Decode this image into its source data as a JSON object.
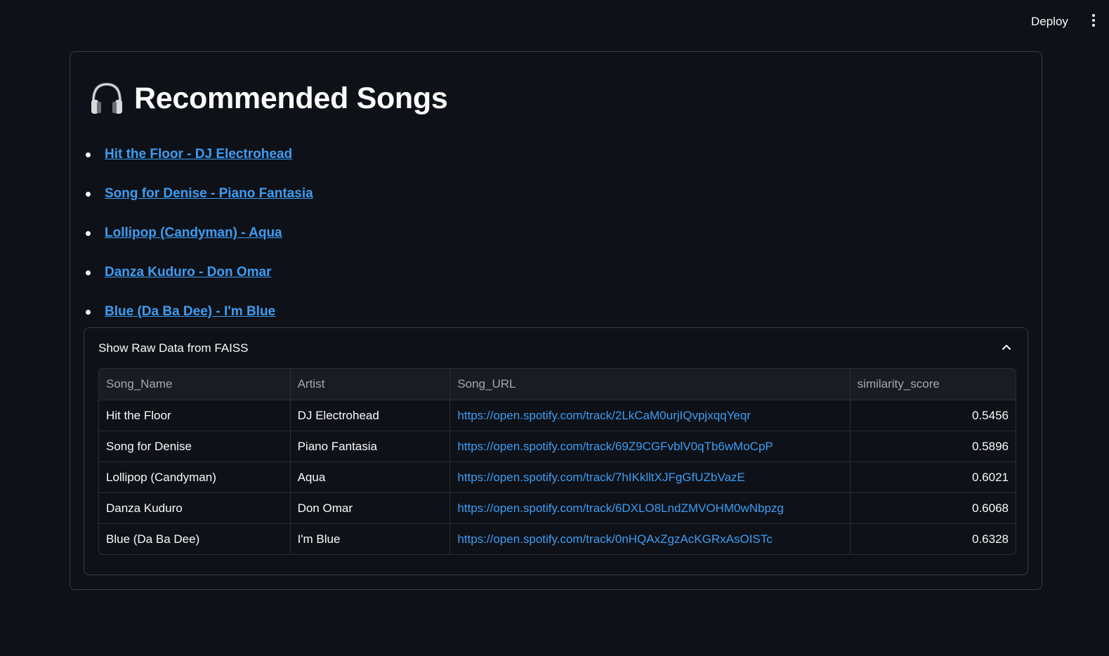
{
  "header": {
    "deploy_label": "Deploy"
  },
  "main": {
    "title": "Recommended Songs",
    "title_icon": "headphones-icon",
    "recommendations": [
      {
        "label": "Hit the Floor - DJ Electrohead"
      },
      {
        "label": "Song for Denise - Piano Fantasia"
      },
      {
        "label": "Lollipop (Candyman) - Aqua"
      },
      {
        "label": "Danza Kuduro - Don Omar"
      },
      {
        "label": "Blue (Da Ba Dee) - I'm Blue"
      }
    ],
    "expander": {
      "label": "Show Raw Data from FAISS",
      "icon": "chevron-up-icon",
      "expanded": true
    },
    "table": {
      "columns": [
        "Song_Name",
        "Artist",
        "Song_URL",
        "similarity_score"
      ],
      "rows": [
        [
          "Hit the Floor",
          "DJ Electrohead",
          "https://open.spotify.com/track/2LkCaM0urjIQvpjxqqYeqr",
          "0.5456"
        ],
        [
          "Song for Denise",
          "Piano Fantasia",
          "https://open.spotify.com/track/69Z9CGFvblV0qTb6wMoCpP",
          "0.5896"
        ],
        [
          "Lollipop (Candyman)",
          "Aqua",
          "https://open.spotify.com/track/7hIKklltXJFgGfUZbVazE",
          "0.6021"
        ],
        [
          "Danza Kuduro",
          "Don Omar",
          "https://open.spotify.com/track/6DXLO8LndZMVOHM0wNbpzg",
          "0.6068"
        ],
        [
          "Blue (Da Ba Dee)",
          "I'm Blue",
          "https://open.spotify.com/track/0nHQAxZgzAcKGRxAsOISTc",
          "0.6328"
        ]
      ]
    }
  },
  "colors": {
    "background": "#0e1117",
    "link": "#3d9df3",
    "border": "#3a3d45",
    "text": "#fafafa",
    "header_text": "#a3a8b4"
  }
}
